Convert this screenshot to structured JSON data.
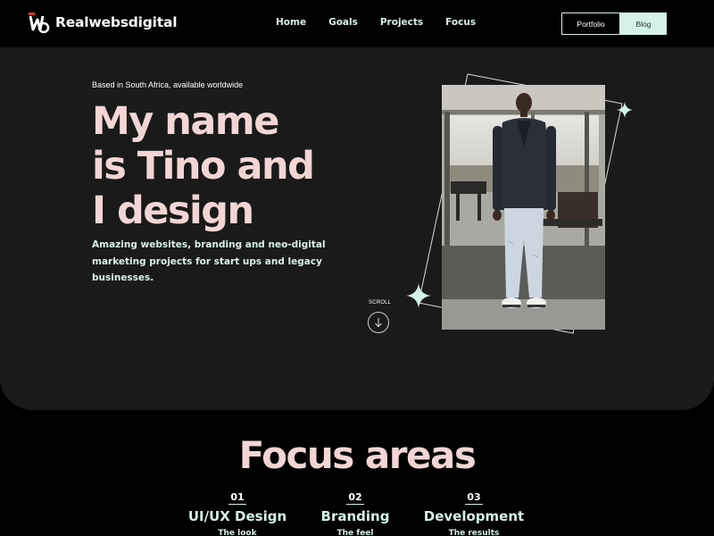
{
  "header": {
    "logo_text": "Realwebsdigital",
    "nav": [
      "Home",
      "Goals",
      "Projects",
      "Focus"
    ],
    "portfolio_label": "Portfolio",
    "blog_label": "Blog"
  },
  "hero": {
    "tagline": "Based in South Africa, available worldwide",
    "headline": [
      "My name",
      "is Tino and",
      "I design"
    ],
    "subtext": "Amazing websites, branding and neo-digital marketing projects for start ups and legacy businesses.",
    "scroll_label": "SCROLL"
  },
  "focus": {
    "title": "Focus areas",
    "items": [
      {
        "num": "01",
        "name": "UI/UX Design",
        "sub": "The look"
      },
      {
        "num": "02",
        "name": "Branding",
        "sub": "The feel"
      },
      {
        "num": "03",
        "name": "Development",
        "sub": "The results"
      }
    ]
  },
  "colors": {
    "accent_pink": "#f3d5d5",
    "accent_mint": "#d4f2e6",
    "hero_bg": "#1a1a1a",
    "page_bg": "#000000"
  }
}
